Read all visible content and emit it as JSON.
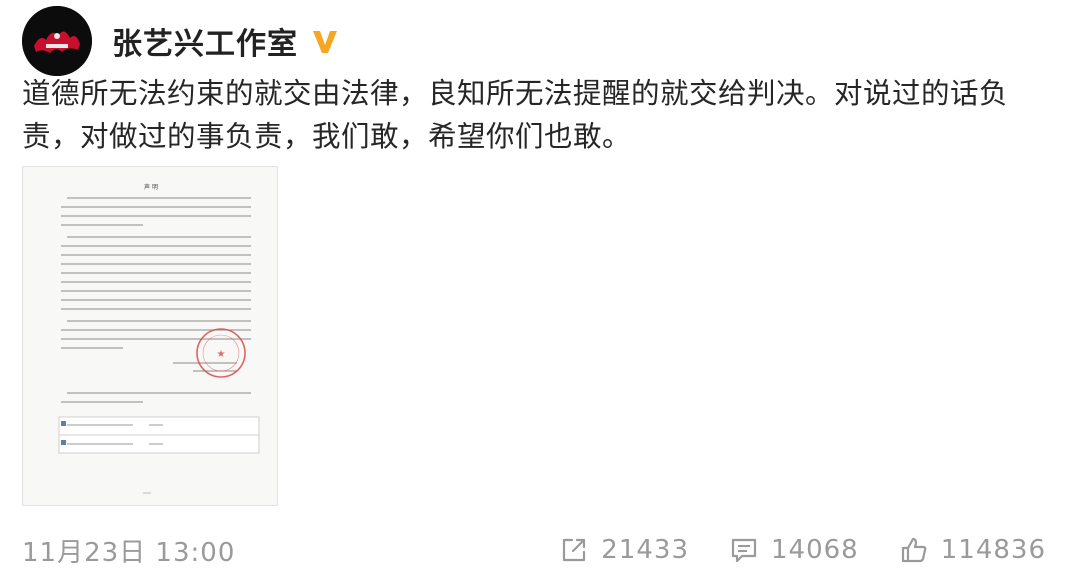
{
  "account": {
    "name": "张艺兴工作室",
    "verified_badge_color": "#f5a623"
  },
  "post": {
    "text": "道德所无法约束的就交由法律，良知所无法提醒的就交给判决。对说过的话负责，对做过的事负责，我们敢，希望你们也敢。",
    "attachment": {
      "type": "document-image",
      "doc_title": "声 明"
    }
  },
  "footer": {
    "timestamp": "11月23日 13:00",
    "share": {
      "icon": "share-icon",
      "count": "21433"
    },
    "comment": {
      "icon": "comment-icon",
      "count": "14068"
    },
    "like": {
      "icon": "thumbs-up-icon",
      "count": "114836"
    }
  },
  "colors": {
    "meta_text": "#9a9a9a",
    "body_text": "#262626",
    "seal_red": "#d94a4a"
  }
}
